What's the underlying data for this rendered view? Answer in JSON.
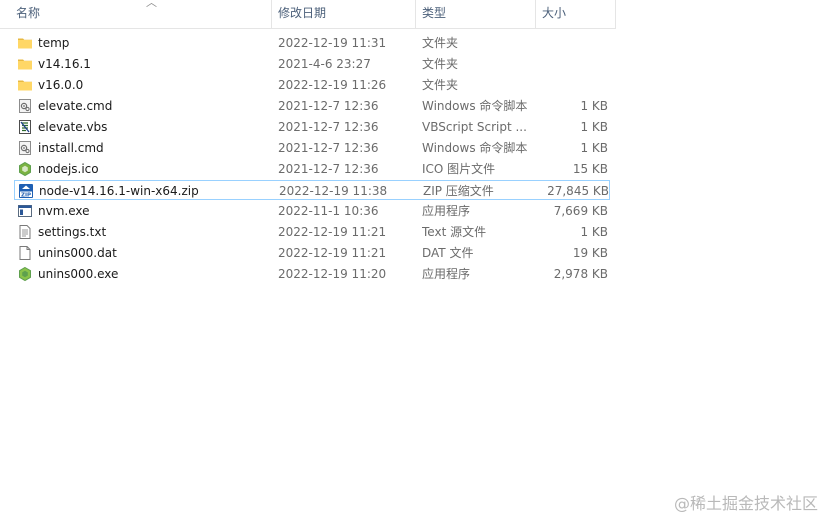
{
  "columns": {
    "name": "名称",
    "date": "修改日期",
    "type": "类型",
    "size": "大小"
  },
  "files": [
    {
      "name": "temp",
      "date": "2022-12-19 11:31",
      "type": "文件夹",
      "size": "",
      "icon": "folder-icon"
    },
    {
      "name": "v14.16.1",
      "date": "2021-4-6 23:27",
      "type": "文件夹",
      "size": "",
      "icon": "folder-icon"
    },
    {
      "name": "v16.0.0",
      "date": "2022-12-19 11:26",
      "type": "文件夹",
      "size": "",
      "icon": "folder-icon"
    },
    {
      "name": "elevate.cmd",
      "date": "2021-12-7 12:36",
      "type": "Windows 命令脚本",
      "size": "1 KB",
      "icon": "cmd-file-icon"
    },
    {
      "name": "elevate.vbs",
      "date": "2021-12-7 12:36",
      "type": "VBScript Script ...",
      "size": "1 KB",
      "icon": "vbs-file-icon"
    },
    {
      "name": "install.cmd",
      "date": "2021-12-7 12:36",
      "type": "Windows 命令脚本",
      "size": "1 KB",
      "icon": "cmd-file-icon"
    },
    {
      "name": "nodejs.ico",
      "date": "2021-12-7 12:36",
      "type": "ICO 图片文件",
      "size": "15 KB",
      "icon": "nodejs-icon"
    },
    {
      "name": "node-v14.16.1-win-x64.zip",
      "date": "2022-12-19 11:38",
      "type": "ZIP 压缩文件",
      "size": "27,845 KB",
      "icon": "zip-file-icon",
      "selected": true
    },
    {
      "name": "nvm.exe",
      "date": "2022-11-1 10:36",
      "type": "应用程序",
      "size": "7,669 KB",
      "icon": "exe-window-icon"
    },
    {
      "name": "settings.txt",
      "date": "2022-12-19 11:21",
      "type": "Text 源文件",
      "size": "1 KB",
      "icon": "text-file-icon"
    },
    {
      "name": "unins000.dat",
      "date": "2022-12-19 11:21",
      "type": "DAT 文件",
      "size": "19 KB",
      "icon": "blank-file-icon"
    },
    {
      "name": "unins000.exe",
      "date": "2022-12-19 11:20",
      "type": "应用程序",
      "size": "2,978 KB",
      "icon": "nodejs-exe-icon"
    }
  ],
  "watermark": "@稀土掘金技术社区",
  "colors": {
    "folder": "#ffd766",
    "selection_border": "#99d1ff",
    "header_text": "#4c607a",
    "nodejs_green": "#5fa04e"
  }
}
